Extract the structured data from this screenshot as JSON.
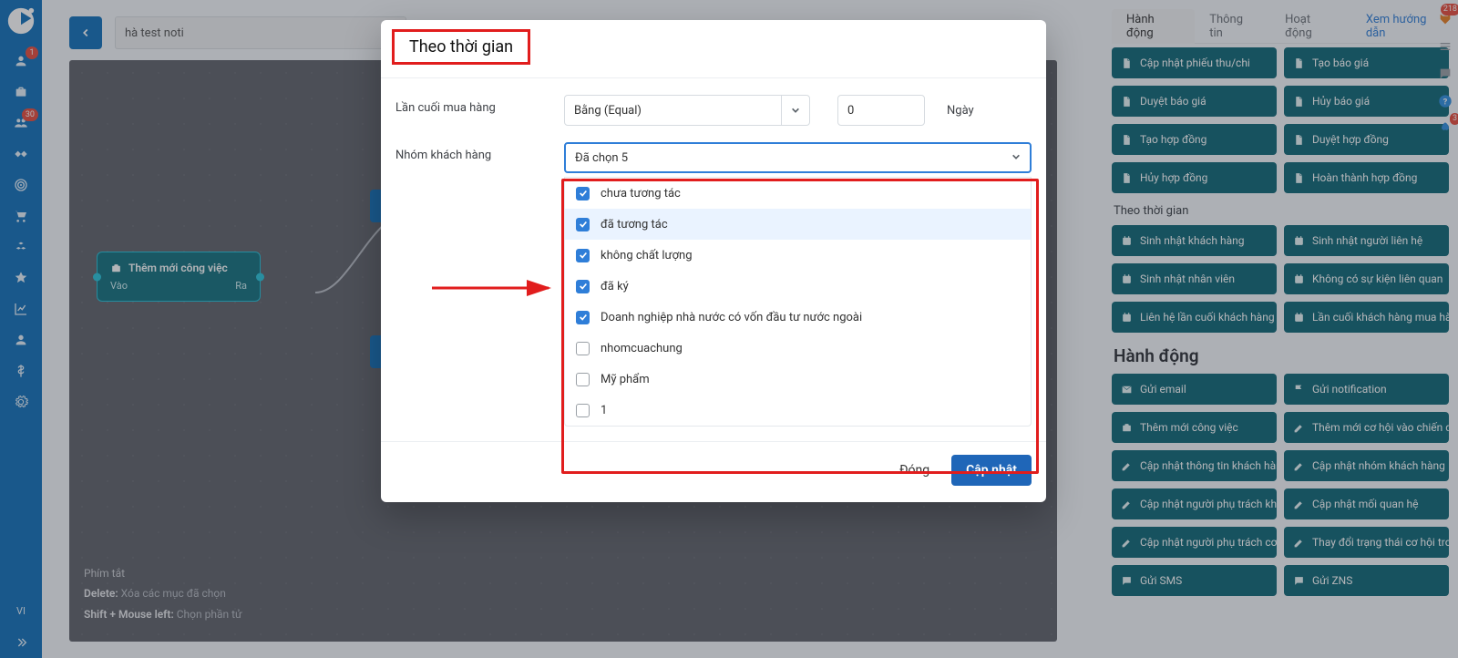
{
  "leftnav": {
    "badges": {
      "users": "1",
      "groups": "30"
    },
    "lang": "VI"
  },
  "topbar": {
    "search_value": "hà test noti"
  },
  "canvas": {
    "node1_title": "Thêm mới công việc",
    "node1_in": "Vào",
    "node1_out": "Ra"
  },
  "shortcuts": {
    "heading": "Phím tắt",
    "delete_key": "Delete:",
    "delete_desc": " Xóa các mục đã chọn",
    "shift_key": "Shift + Mouse left:",
    "shift_desc": " Chọn phần tử"
  },
  "rightpanel": {
    "tabs": {
      "t1": "Hành động",
      "t2": "Thông tin",
      "t3": "Hoạt động",
      "link": "Xem hướng dẫn"
    },
    "section_time": "Theo thời gian",
    "section_action": "Hành động",
    "doc_actions": [
      "Cập nhật phiếu thu/chi",
      "Tạo báo giá",
      "Duyệt báo giá",
      "Hủy báo giá",
      "Tạo hợp đồng",
      "Duyệt hợp đồng",
      "Hủy hợp đồng",
      "Hoàn thành hợp đồng"
    ],
    "time_actions": [
      "Sinh nhật khách hàng",
      "Sinh nhật người liên hệ",
      "Sinh nhật nhân viên",
      "Không có sự kiện liên quan",
      "Liên hệ lần cuối khách hàng",
      "Lần cuối khách hàng mua hàng"
    ],
    "main_actions": [
      {
        "icon": "mail",
        "label": "Gửi email"
      },
      {
        "icon": "flag",
        "label": "Gửi notification"
      },
      {
        "icon": "briefcase",
        "label": "Thêm mới công việc"
      },
      {
        "icon": "edit",
        "label": "Thêm mới cơ hội vào chiến d..."
      },
      {
        "icon": "edit",
        "label": "Cập nhật thông tin khách hàng"
      },
      {
        "icon": "edit",
        "label": "Cập nhật nhóm khách hàng"
      },
      {
        "icon": "edit",
        "label": "Cập nhật người phụ trách kh..."
      },
      {
        "icon": "edit",
        "label": "Cập nhật mối quan hệ"
      },
      {
        "icon": "edit",
        "label": "Cập nhật người phụ trách cơ..."
      },
      {
        "icon": "edit",
        "label": "Thay đổi trạng thái cơ hội tro..."
      },
      {
        "icon": "chat",
        "label": "Gửi SMS"
      },
      {
        "icon": "chat",
        "label": "Gửi ZNS"
      }
    ]
  },
  "edge_badges": {
    "rocket": "3",
    "fox": "218"
  },
  "modal": {
    "title": "Theo thời gian",
    "row1_label": "Lần cuối mua hàng",
    "row1_select": "Bằng (Equal)",
    "row1_num": "0",
    "row1_unit": "Ngày",
    "row2_label": "Nhóm khách hàng",
    "row2_selected": "Đã chọn 5",
    "options": [
      {
        "checked": true,
        "label": "chưa tương tác"
      },
      {
        "checked": true,
        "label": "đã tương tác",
        "hover": true
      },
      {
        "checked": true,
        "label": "không chất lượng"
      },
      {
        "checked": true,
        "label": "đã ký"
      },
      {
        "checked": true,
        "label": "Doanh nghiệp nhà nước có vốn đầu tư nước ngoài"
      },
      {
        "checked": false,
        "label": "nhomcuachung"
      },
      {
        "checked": false,
        "label": "Mỹ phẩm"
      },
      {
        "checked": false,
        "label": "1"
      }
    ],
    "footer": {
      "close": "Đóng",
      "update": "Cập nhật"
    }
  }
}
